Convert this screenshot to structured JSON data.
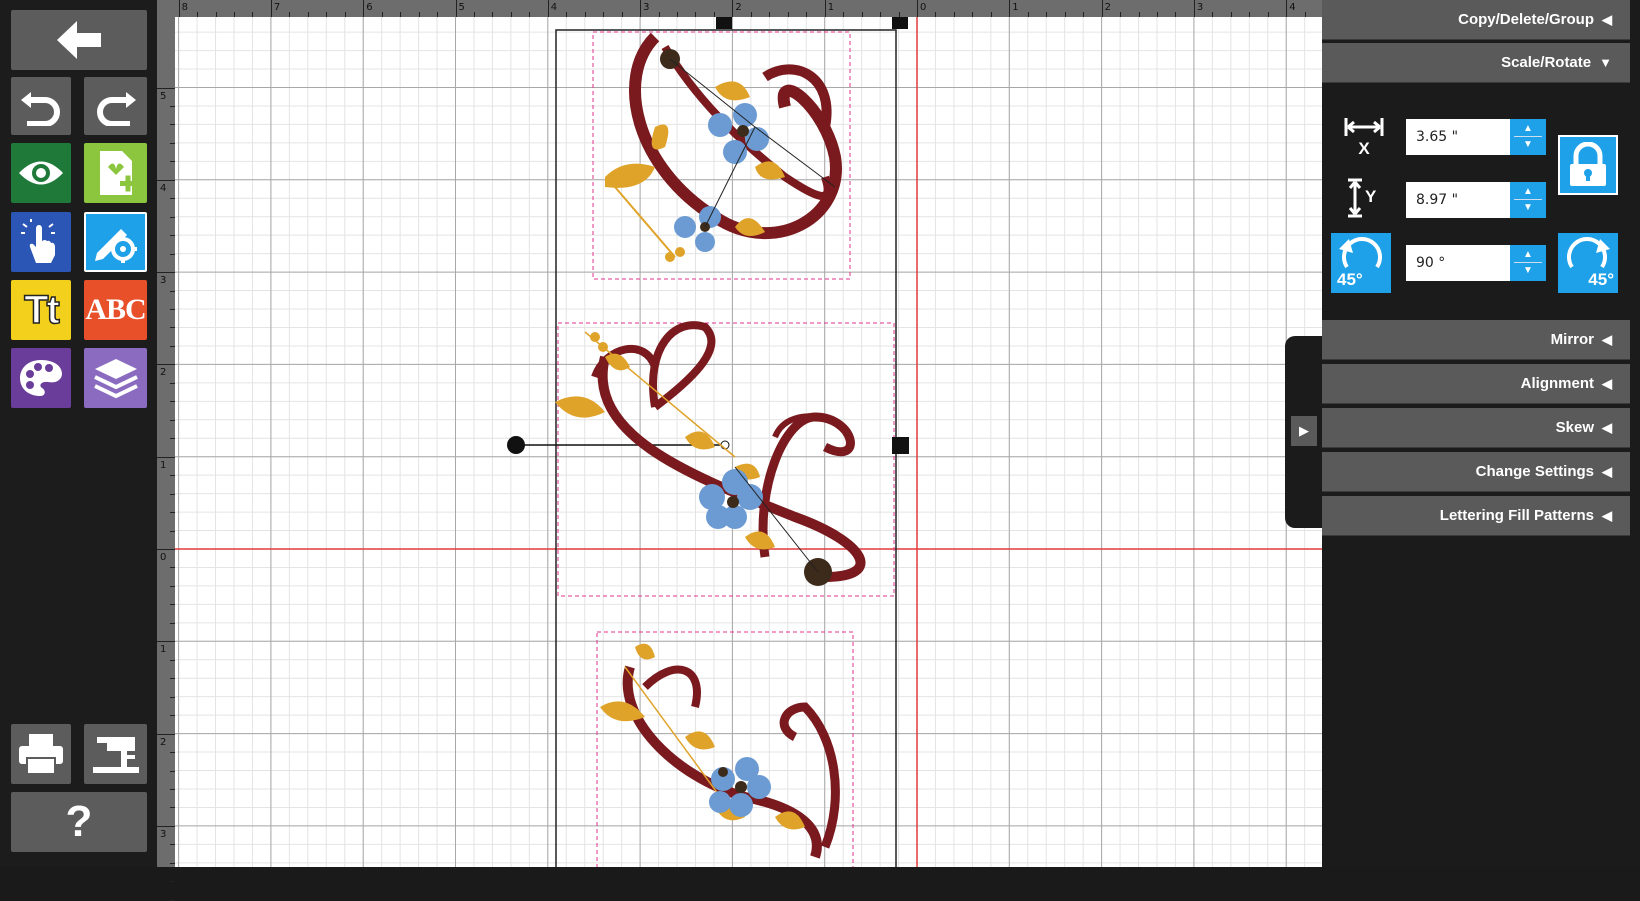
{
  "app": {
    "accent": "#1ea1e8",
    "grid_origin_color": "#e23a3a"
  },
  "toolbar": {
    "buttons": [
      {
        "name": "back-button",
        "icon": "arrow-left-icon"
      },
      {
        "name": "undo-button",
        "icon": "undo-icon"
      },
      {
        "name": "redo-button",
        "icon": "redo-icon"
      },
      {
        "name": "view-button",
        "icon": "eye-icon",
        "color": "#1f7a3a"
      },
      {
        "name": "add-design-button",
        "icon": "add-design-icon",
        "color": "#8cc63f"
      },
      {
        "name": "select-button",
        "icon": "touch-select-icon",
        "color": "#2b56b5"
      },
      {
        "name": "edit-button",
        "icon": "edit-settings-icon",
        "color": "#1ea1e8"
      },
      {
        "name": "text-button",
        "icon": "text-icon",
        "label": "Tt",
        "color": "#f2d01b"
      },
      {
        "name": "monogram-button",
        "icon": "monogram-icon",
        "label": "ABC",
        "color": "#e8502a"
      },
      {
        "name": "colors-button",
        "icon": "palette-icon",
        "color": "#6a3d9a"
      },
      {
        "name": "layers-button",
        "icon": "layers-icon",
        "color": "#8a6bbf"
      },
      {
        "name": "print-button",
        "icon": "printer-icon"
      },
      {
        "name": "sew-button",
        "icon": "sewing-machine-icon"
      },
      {
        "name": "help-button",
        "icon": "help-icon",
        "label": "?"
      }
    ]
  },
  "ruler": {
    "top": [
      "8",
      "7",
      "6",
      "5",
      "4",
      "3",
      "2",
      "1",
      "0",
      "1",
      "2",
      "3",
      "4"
    ],
    "left": [
      "5",
      "4",
      "3",
      "2",
      "1",
      "0",
      "1",
      "2",
      "3"
    ]
  },
  "panel": {
    "sections": {
      "copy_delete_group": "Copy/Delete/Group",
      "scale_rotate": "Scale/Rotate",
      "mirror": "Mirror",
      "alignment": "Alignment",
      "skew": "Skew",
      "change_settings": "Change Settings",
      "lettering_fill_patterns": "Lettering Fill Patterns"
    },
    "arrows": {
      "collapsed": "◀",
      "expanded": "▼"
    },
    "scale": {
      "x_value": "3.65 \"",
      "y_value": "8.97 \"",
      "rotation_value": "90 °",
      "x_label": "X",
      "y_label": "Y",
      "rotate_step": "45°"
    }
  },
  "side_toggle": "▶"
}
